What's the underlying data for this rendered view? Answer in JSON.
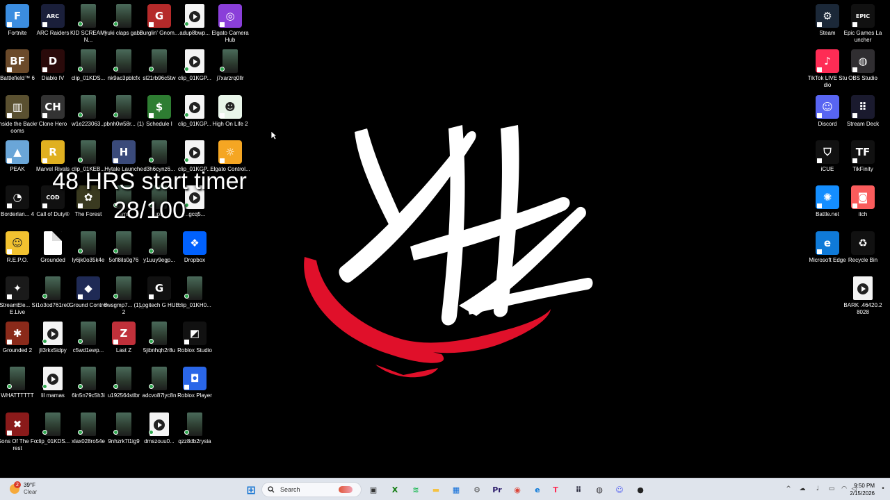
{
  "desktop": {
    "icons": [
      {
        "label": "Fortnite",
        "icon": "fortnite-icon",
        "color": "#3b8de0",
        "glyph": "F",
        "kind": "app",
        "sc": true
      },
      {
        "label": "ARC Raiders",
        "icon": "arc-raiders-icon",
        "color": "#1a1f3a",
        "glyph": "ARC",
        "kind": "app",
        "sc": true
      },
      {
        "label": "KID SCREAMIN...",
        "icon": "clip-file-icon",
        "kind": "phone",
        "sync": true
      },
      {
        "label": "yuki claps gabe",
        "icon": "clip-file-icon",
        "kind": "phone",
        "sync": true
      },
      {
        "label": "Burglin' Gnom...",
        "icon": "burglin-gnomes-icon",
        "color": "#b52a2a",
        "glyph": "G",
        "kind": "app",
        "sc": true
      },
      {
        "label": "adup8bwp...",
        "icon": "video-file-icon",
        "kind": "video",
        "sync": true
      },
      {
        "label": "Elgato Camera Hub",
        "icon": "elgato-camera-hub-icon",
        "color": "#8a3fd9",
        "glyph": "◎",
        "kind": "app",
        "sc": true
      },
      {
        "label": "Battlefield™ 6",
        "icon": "battlefield-6-icon",
        "color": "#6b4a2a",
        "glyph": "BF",
        "kind": "app",
        "sc": true
      },
      {
        "label": "Diablo IV",
        "icon": "diablo-4-icon",
        "color": "#2a0a0a",
        "glyph": "D",
        "kind": "app",
        "sc": true
      },
      {
        "label": "clip_01KDS...",
        "icon": "clip-file-icon",
        "kind": "phone",
        "sync": true
      },
      {
        "label": "nk9ac3pblcfx",
        "icon": "clip-file-icon",
        "kind": "phone",
        "sync": true
      },
      {
        "label": "sl21rb96c5tw",
        "icon": "clip-file-icon",
        "kind": "phone",
        "sync": true
      },
      {
        "label": "clip_01KGP...",
        "icon": "video-file-icon",
        "kind": "video",
        "sync": true
      },
      {
        "label": "j7xarzrq0llr",
        "icon": "clip-file-icon",
        "kind": "phone",
        "sync": true
      },
      {
        "label": "Inside the Backrooms",
        "icon": "inside-the-backrooms-icon",
        "color": "#5a5030",
        "glyph": "▥",
        "kind": "app",
        "sc": true
      },
      {
        "label": "Clone Hero",
        "icon": "clone-hero-icon",
        "color": "#333333",
        "glyph": "CH",
        "kind": "app",
        "sc": true
      },
      {
        "label": "w1e223063...",
        "icon": "clip-file-icon",
        "kind": "phone",
        "sync": true
      },
      {
        "label": "pbnh0w58r... (1)",
        "icon": "clip-file-icon",
        "kind": "phone",
        "sync": true
      },
      {
        "label": "Schedule I",
        "icon": "schedule-1-icon",
        "color": "#2e7d32",
        "glyph": "$",
        "kind": "app",
        "sc": true
      },
      {
        "label": "clip_01KGP...",
        "icon": "video-file-icon",
        "kind": "video",
        "sync": true
      },
      {
        "label": "High On Life 2",
        "icon": "high-on-life-2-icon",
        "color": "#e8f5e9",
        "glyph": "☻",
        "kind": "app",
        "sc": true
      },
      {
        "label": "PEAK",
        "icon": "peak-icon",
        "color": "#6aa6d8",
        "glyph": "▲",
        "kind": "app",
        "sc": true
      },
      {
        "label": "Marvel Rivals",
        "icon": "marvel-rivals-icon",
        "color": "#e0b020",
        "glyph": "R",
        "kind": "app",
        "sc": true
      },
      {
        "label": "clip_01KEB...",
        "icon": "clip-file-icon",
        "kind": "phone",
        "sync": true
      },
      {
        "label": "Hytale Launcher",
        "icon": "hytale-launcher-icon",
        "color": "#3a4a7a",
        "glyph": "H",
        "kind": "app",
        "sc": true
      },
      {
        "label": "d3h6cynz6...",
        "icon": "clip-file-icon",
        "kind": "phone",
        "sync": true
      },
      {
        "label": "clip_01KGP...",
        "icon": "video-file-icon",
        "kind": "video",
        "sync": true
      },
      {
        "label": "Elgato Control...",
        "icon": "elgato-control-center-icon",
        "color": "#f5a623",
        "glyph": "☼",
        "kind": "app",
        "sc": true
      },
      {
        "label": "Borderlan... 4",
        "icon": "borderlands-4-icon",
        "color": "#111111",
        "glyph": "◔",
        "kind": "app",
        "sc": true
      },
      {
        "label": "Call of Duty®",
        "icon": "call-of-duty-icon",
        "color": "#111111",
        "glyph": "COD",
        "kind": "app",
        "sc": true
      },
      {
        "label": "The Forest",
        "icon": "the-forest-icon",
        "color": "#3a3a20",
        "glyph": "✿",
        "kind": "app",
        "sc": true
      },
      {
        "label": "aem...",
        "icon": "clip-file-icon",
        "kind": "phone",
        "sync": true
      },
      {
        "label": "up...",
        "icon": "clip-file-icon",
        "kind": "phone",
        "sync": true
      },
      {
        "label": "...gcq5...",
        "icon": "video-file-icon",
        "kind": "video",
        "sync": true
      },
      {
        "label": "R.E.P.O.",
        "icon": "repo-icon",
        "color": "#f2c230",
        "glyph": "☺",
        "kind": "app",
        "sc": true
      },
      {
        "label": "Grounded",
        "icon": "grounded-file-icon",
        "kind": "file"
      },
      {
        "label": "ly6jk0o35k4e",
        "icon": "clip-file-icon",
        "kind": "phone",
        "sync": true
      },
      {
        "label": "5ofl8ils0g76",
        "icon": "clip-file-icon",
        "kind": "phone",
        "sync": true
      },
      {
        "label": "y1uuy9egp...",
        "icon": "clip-file-icon",
        "kind": "phone",
        "sync": true
      },
      {
        "label": "Dropbox",
        "icon": "dropbox-icon",
        "color": "#0061fe",
        "glyph": "❖",
        "kind": "app",
        "sc": false
      },
      {
        "label": "StreamEle... SE.Live",
        "icon": "streamelements-se-live-icon",
        "color": "#1a1a1a",
        "glyph": "✦",
        "kind": "app",
        "sc": true
      },
      {
        "label": "i1o3od761re0",
        "icon": "clip-file-icon",
        "kind": "phone",
        "sync": true
      },
      {
        "label": "Ground Control",
        "icon": "ground-control-icon",
        "color": "#1f2a55",
        "glyph": "◆",
        "kind": "app",
        "sc": true
      },
      {
        "label": "6wsgmp7... (1)_2",
        "icon": "clip-file-icon",
        "kind": "phone",
        "sync": true
      },
      {
        "label": "Logitech G HUB",
        "icon": "logitech-g-hub-icon",
        "color": "#111111",
        "glyph": "G",
        "kind": "app",
        "sc": true
      },
      {
        "label": "clip_01KH0...",
        "icon": "clip-file-icon",
        "kind": "phone",
        "sync": true
      },
      {
        "label": "Grounded 2",
        "icon": "grounded-2-icon",
        "color": "#8a2a1a",
        "glyph": "✱",
        "kind": "app",
        "sc": true
      },
      {
        "label": "jll3rkx5idpy",
        "icon": "video-file-icon",
        "kind": "video",
        "sync": true
      },
      {
        "label": "c5wd1ewp...",
        "icon": "clip-file-icon",
        "kind": "phone",
        "sync": true
      },
      {
        "label": "Last Z",
        "icon": "last-z-icon",
        "color": "#c0303a",
        "glyph": "Z",
        "kind": "app",
        "sc": true
      },
      {
        "label": "5jibnhqh2r8u",
        "icon": "clip-file-icon",
        "kind": "phone",
        "sync": true
      },
      {
        "label": "Roblox Studio",
        "icon": "roblox-studio-icon",
        "color": "#111111",
        "glyph": "◩",
        "kind": "app",
        "sc": true
      },
      {
        "label": "WHATTTTTT",
        "icon": "clip-file-icon",
        "kind": "phone",
        "sync": true
      },
      {
        "label": "lil mamas",
        "icon": "video-file-icon",
        "kind": "video",
        "sync": true
      },
      {
        "label": "6in5n79c5h3i",
        "icon": "clip-file-icon",
        "kind": "phone",
        "sync": true
      },
      {
        "label": "u192564stlbr",
        "icon": "clip-file-icon",
        "kind": "phone",
        "sync": true
      },
      {
        "label": "adcvo87lyc8n",
        "icon": "clip-file-icon",
        "kind": "phone",
        "sync": true
      },
      {
        "label": "Roblox Player",
        "icon": "roblox-player-icon",
        "color": "#2a66e8",
        "glyph": "◘",
        "kind": "app",
        "sc": true
      },
      {
        "label": "Sons Of The Forest",
        "icon": "sons-of-the-forest-icon",
        "color": "#8a1a1a",
        "glyph": "✖",
        "kind": "app",
        "sc": true
      },
      {
        "label": "clip_01KDS...",
        "icon": "clip-file-icon",
        "kind": "phone",
        "sync": true
      },
      {
        "label": "xlax028ro54e",
        "icon": "clip-file-icon",
        "kind": "phone",
        "sync": true
      },
      {
        "label": "9nhzrk7l1ig9",
        "icon": "clip-file-icon",
        "kind": "phone",
        "sync": true
      },
      {
        "label": "dmszouu0...",
        "icon": "video-file-icon",
        "kind": "video",
        "sync": true
      },
      {
        "label": "qzz8db2rysia",
        "icon": "clip-file-icon",
        "kind": "phone",
        "sync": true
      }
    ],
    "right_icons": [
      {
        "label": "Steam",
        "icon": "steam-icon",
        "color": "#1b2838",
        "glyph": "⚙",
        "kind": "app",
        "sc": true
      },
      {
        "label": "Epic Games Launcher",
        "icon": "epic-games-launcher-icon",
        "color": "#111111",
        "glyph": "EPIC",
        "kind": "app",
        "sc": true
      },
      {
        "label": "TikTok LIVE Studio",
        "icon": "tiktok-live-studio-icon",
        "color": "#fe2c55",
        "glyph": "♪",
        "kind": "app",
        "sc": true
      },
      {
        "label": "OBS Studio",
        "icon": "obs-studio-icon",
        "color": "#302e31",
        "glyph": "◍",
        "kind": "app",
        "sc": true
      },
      {
        "label": "Discord",
        "icon": "discord-icon",
        "color": "#5865f2",
        "glyph": "☺",
        "kind": "app",
        "sc": true
      },
      {
        "label": "Stream Deck",
        "icon": "stream-deck-icon",
        "color": "#1a1a2e",
        "glyph": "⠿",
        "kind": "app",
        "sc": true
      },
      {
        "label": "iCUE",
        "icon": "icue-icon",
        "color": "#111111",
        "glyph": "⛉",
        "kind": "app",
        "sc": true
      },
      {
        "label": "TikFinity",
        "icon": "tikfinity-icon",
        "color": "#111111",
        "glyph": "TF",
        "kind": "app",
        "sc": true
      },
      {
        "label": "Battle.net",
        "icon": "battle-net-icon",
        "color": "#148eff",
        "glyph": "✺",
        "kind": "app",
        "sc": true
      },
      {
        "label": "itch",
        "icon": "itch-icon",
        "color": "#fa5c5c",
        "glyph": "◙",
        "kind": "app",
        "sc": true
      },
      {
        "label": "Microsoft Edge",
        "icon": "microsoft-edge-icon",
        "color": "#0f7ad8",
        "glyph": "e",
        "kind": "app",
        "sc": true
      },
      {
        "label": "Recycle Bin",
        "icon": "recycle-bin-icon",
        "color": "#111111",
        "glyph": "♻",
        "kind": "app",
        "sc": false
      },
      {
        "label": "BARK .46420.28028",
        "icon": "video-file-icon",
        "kind": "video",
        "sync": false
      }
    ]
  },
  "overlay": {
    "line1": "48 HRS start timer",
    "line2": "28/100"
  },
  "logo": {
    "icon": "xhz-logo",
    "white": "#ffffff",
    "red": "#e0102a"
  },
  "taskbar": {
    "weather": {
      "temp": "39°F",
      "condition": "Clear",
      "alert": "2"
    },
    "search_placeholder": "Search",
    "apps": [
      {
        "icon": "windows-start-icon",
        "color": "#1976d2",
        "glyph": "⊞"
      },
      {
        "icon": "task-view-icon",
        "color": "#333333",
        "glyph": "▣"
      },
      {
        "icon": "xbox-icon",
        "color": "#107c10",
        "glyph": "X"
      },
      {
        "icon": "spotify-icon",
        "color": "#1db954",
        "glyph": "≋"
      },
      {
        "icon": "file-explorer-icon",
        "color": "#f5c242",
        "glyph": "▬"
      },
      {
        "icon": "microsoft-store-icon",
        "color": "#0a6ad8",
        "glyph": "▦"
      },
      {
        "icon": "settings-icon",
        "color": "#555555",
        "glyph": "⚙"
      },
      {
        "icon": "premiere-pro-icon",
        "color": "#2a1a6a",
        "glyph": "Pr"
      },
      {
        "icon": "chrome-icon",
        "color": "#db4437",
        "glyph": "◉"
      },
      {
        "icon": "edge-icon",
        "color": "#0f7ad8",
        "glyph": "e"
      },
      {
        "icon": "tiktok-live-icon",
        "color": "#fe2c55",
        "glyph": "T"
      },
      {
        "icon": "stream-deck-icon",
        "color": "#1a1a2e",
        "glyph": "⠿"
      },
      {
        "icon": "obs-icon",
        "color": "#302e31",
        "glyph": "◍"
      },
      {
        "icon": "discord-icon",
        "color": "#5865f2",
        "glyph": "☺"
      },
      {
        "icon": "game-app-icon",
        "color": "#222222",
        "glyph": "●"
      }
    ],
    "clock": {
      "time": "9:50 PM",
      "date": "2/15/2026"
    }
  }
}
